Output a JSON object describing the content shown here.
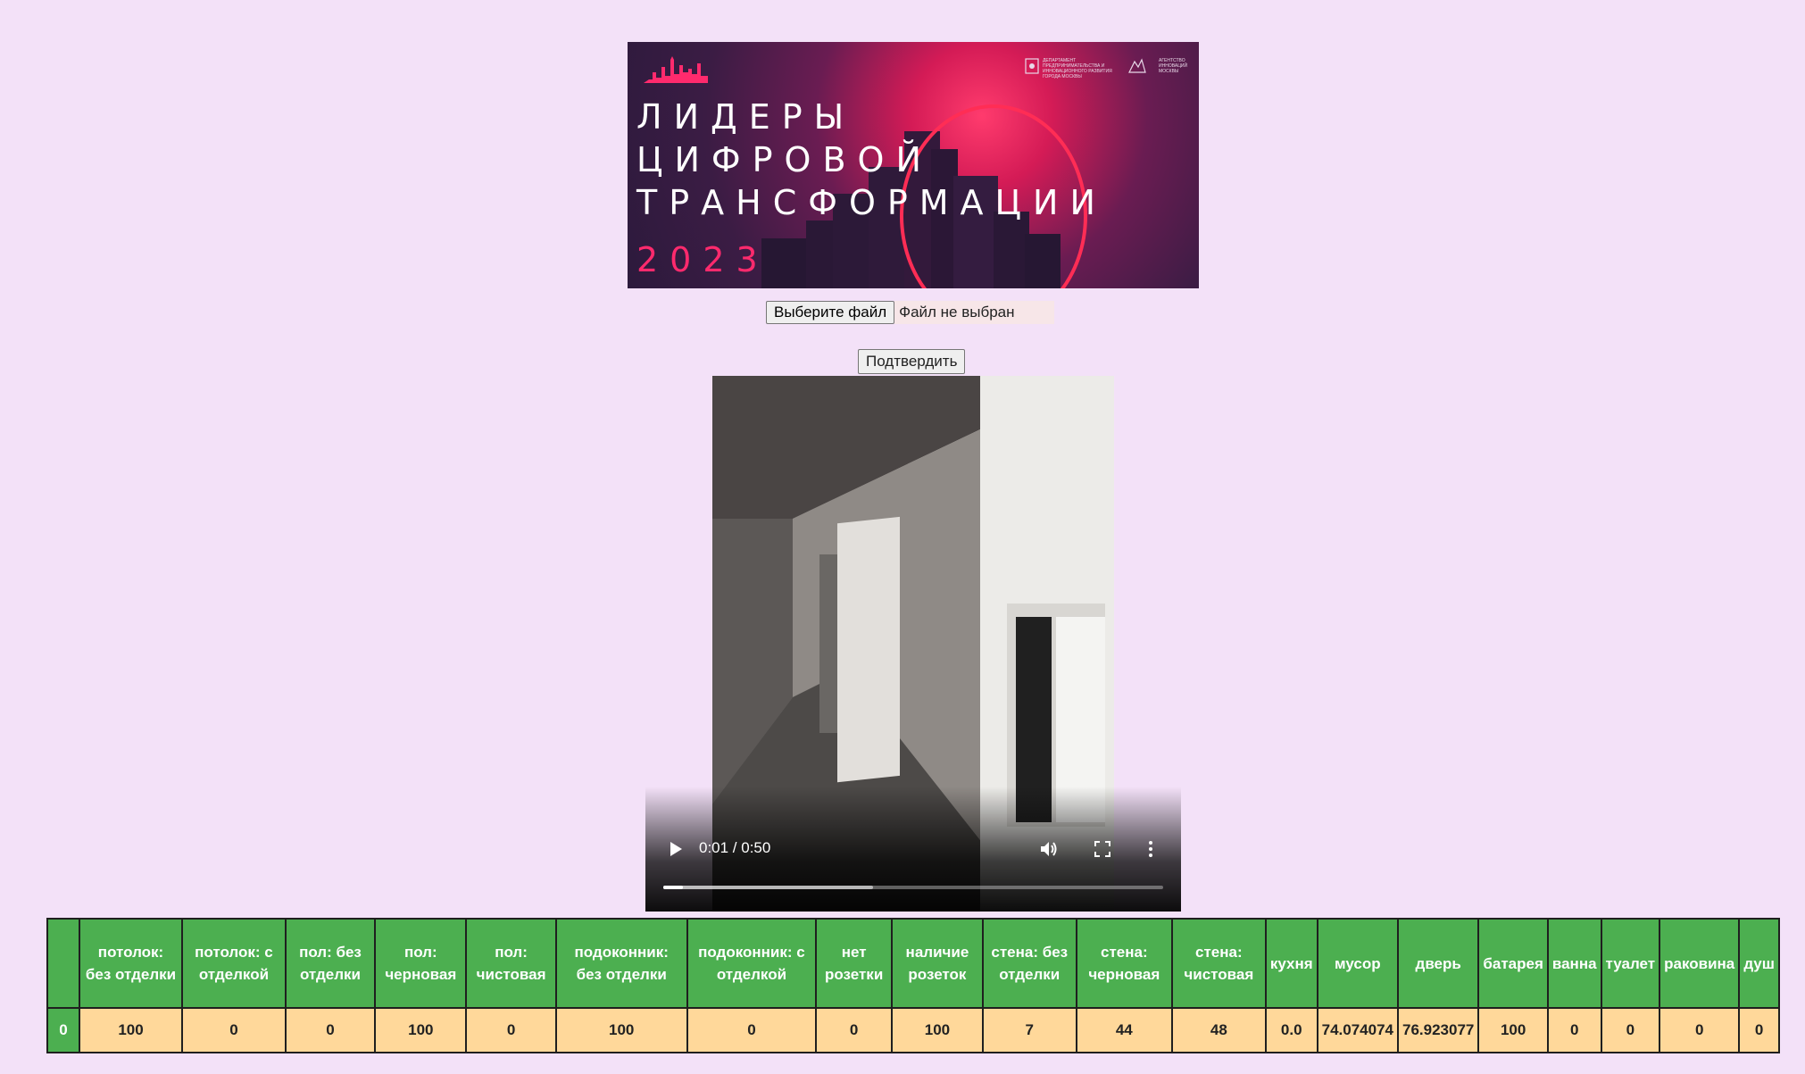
{
  "banner": {
    "title_lines": [
      "ЛИДЕРЫ",
      "ЦИФРОВОЙ",
      "ТРАНСФОРМАЦИИ"
    ],
    "year": "2023",
    "partner_1": "ДЕПАРТАМЕНТ ПРЕДПРИНИМАТЕЛЬСТВА И ИННОВАЦИОННОГО РАЗВИТИЯ ГОРОДА МОСКВЫ",
    "partner_2": "АГЕНТСТВО ИННОВАЦИЙ МОСКВЫ"
  },
  "upload": {
    "choose_label": "Выберите файл",
    "status": "Файл не выбран",
    "submit_label": "Подтвердить"
  },
  "video": {
    "time": "0:01 / 0:50",
    "played_fraction": 0.04,
    "buffered_fraction": 0.42,
    "icons": [
      "play-icon",
      "volume-icon",
      "fullscreen-icon",
      "more-icon"
    ]
  },
  "table": {
    "headers": [
      "",
      "потолок: без отделки",
      "потолок: с отделкой",
      "пол: без отделки",
      "пол: черновая",
      "пол: чистовая",
      "подоконник: без отделки",
      "подоконник: с отделкой",
      "нет розетки",
      "наличие розеток",
      "стена: без отделки",
      "стена: черновая",
      "стена: чистовая",
      "кухня",
      "мусор",
      "дверь",
      "батарея",
      "ванна",
      "туалет",
      "раковина",
      "душ"
    ],
    "rows": [
      [
        "0",
        "100",
        "0",
        "0",
        "100",
        "0",
        "100",
        "0",
        "0",
        "100",
        "7",
        "44",
        "48",
        "0.0",
        "74.074074",
        "76.923077",
        "100",
        "0",
        "0",
        "0",
        "0"
      ]
    ]
  },
  "colors": {
    "page_bg": "#f3e1f8",
    "header_bg": "#4caf50",
    "cell_bg": "#ffd89a",
    "accent": "#ff2a6d"
  }
}
